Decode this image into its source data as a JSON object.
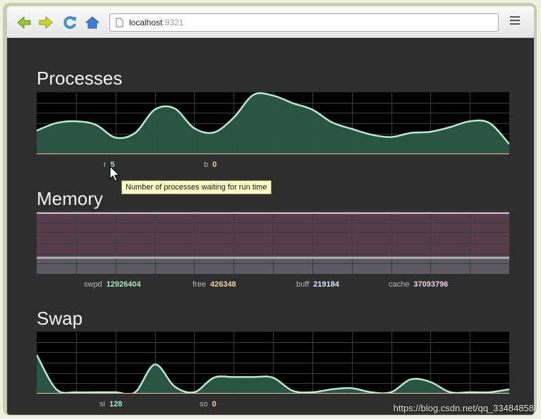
{
  "browser": {
    "url_host": "localhost",
    "url_port": ":9321",
    "icons": [
      "back-arrow-icon",
      "forward-arrow-icon",
      "reload-icon",
      "home-icon",
      "page-icon",
      "menu-icon"
    ]
  },
  "sections": {
    "processes": {
      "title": "Processes",
      "r_label": "r",
      "r_value": "5",
      "b_label": "b",
      "b_value": "0"
    },
    "memory": {
      "title": "Memory",
      "swpd_label": "swpd",
      "swpd_value": "12926404",
      "free_label": "free",
      "free_value": "426348",
      "buff_label": "buff",
      "buff_value": "219184",
      "cache_label": "cache",
      "cache_value": "37093796"
    },
    "swap": {
      "title": "Swap",
      "si_label": "si",
      "si_value": "128",
      "so_label": "so",
      "so_value": "0"
    }
  },
  "tooltip": {
    "text": "Number of processes waiting for run time"
  },
  "watermark": {
    "text": "https://blog.csdn.net/qq_33484858"
  },
  "colors": {
    "chart_bg": "#000000",
    "grid": "#3c3c3c",
    "area_fill": "#2f5a49",
    "area_line": "#b9ead6",
    "baseline": "#e8c89a",
    "mem_cache": "#563d4a",
    "mem_buff": "#5c5a60",
    "mem_line_top": "#f0d8f0",
    "mem_line_mid": "#b0b0b0",
    "legend_green": "#a8e6c8",
    "legend_peach": "#f5d3a6",
    "legend_blue": "#dfe3ff",
    "legend_pink": "#f0d0ee"
  },
  "chart_data": [
    {
      "type": "area",
      "x": [
        0,
        0.5,
        1,
        1.5,
        2,
        2.5,
        3,
        3.5,
        4,
        4.5,
        5,
        5.5,
        6,
        6.5,
        7,
        7.5,
        8,
        8.5,
        9,
        9.5,
        10,
        10.5,
        11,
        11.5,
        12
      ],
      "values": [
        3.8,
        5.1,
        5.4,
        4.8,
        2.6,
        3.4,
        7.4,
        7.6,
        4.2,
        3.5,
        6.0,
        9.9,
        9.8,
        8.5,
        7.4,
        5.2,
        4.1,
        3.1,
        2.7,
        3.4,
        3.6,
        4.4,
        5.4,
        5.1,
        1.5
      ],
      "ylim": [
        0,
        10
      ],
      "grid": true
    },
    {
      "type": "area",
      "series": [
        {
          "name": "swpd",
          "values": [
            12926404
          ]
        },
        {
          "name": "free",
          "values": [
            426348
          ]
        },
        {
          "name": "buff",
          "values": [
            219184
          ]
        },
        {
          "name": "cache",
          "values": [
            37093796
          ]
        }
      ],
      "grid": true
    },
    {
      "type": "area",
      "x": [
        0,
        0.5,
        1,
        1.5,
        2,
        2.5,
        3,
        3.5,
        4,
        4.5,
        5,
        5.5,
        6,
        6.5,
        7,
        7.5,
        8,
        8.5,
        9,
        9.5,
        10,
        10.5,
        11,
        11.5,
        12
      ],
      "values": [
        128,
        10,
        0,
        0,
        0,
        0,
        95,
        20,
        0,
        50,
        52,
        52,
        50,
        5,
        0,
        10,
        14,
        0,
        0,
        44,
        35,
        0,
        0,
        0,
        10
      ],
      "ylim": [
        0,
        200
      ],
      "grid": true
    }
  ]
}
